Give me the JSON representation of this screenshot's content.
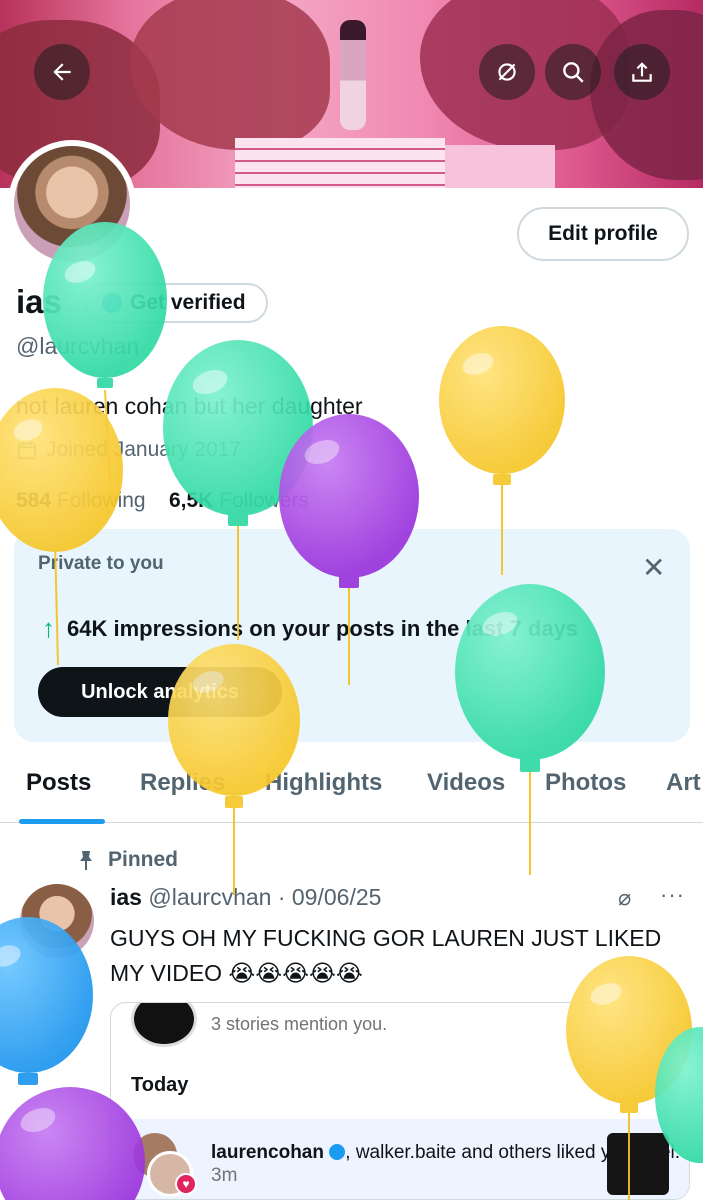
{
  "header": {
    "back_icon": "arrow-left-icon",
    "grok_icon": "grok-icon",
    "search_icon": "search-icon",
    "share_icon": "share-icon"
  },
  "profile": {
    "name": "ias",
    "get_verified": "Get verified",
    "handle": "@laurcvhan",
    "bio": "not lauren cohan but her daughter",
    "joined": "Joined January 2017",
    "following_count": "584",
    "following_label": "Following",
    "followers_count": "6,5K",
    "followers_label": "Followers",
    "edit_profile": "Edit profile"
  },
  "analytics_card": {
    "title": "Private to you",
    "impressions": "64K impressions on your posts in the last 7 days",
    "unlock": "Unlock analytics",
    "accent": "#00ba7c"
  },
  "tabs": [
    {
      "label": "Posts",
      "active": true
    },
    {
      "label": "Replies"
    },
    {
      "label": "Highlights"
    },
    {
      "label": "Videos"
    },
    {
      "label": "Photos"
    },
    {
      "label": "Art"
    }
  ],
  "post": {
    "pinned": "Pinned",
    "author": "ias",
    "handle_date": "@laurcvhan · 09/06/25",
    "text": "GUYS OH MY FUCKING GOR LAUREN JUST LIKED MY VIDEO 😭😭😭😭😭",
    "embed": {
      "mention": "3 stories mention you.",
      "today": "Today",
      "user1": "laurencohan",
      "rest": ", walker.baite and others liked your reel.",
      "time": "3m"
    }
  },
  "colors": {
    "brand_blue": "#1d9bf0",
    "balloon_green": "#3be3b0",
    "balloon_yellow": "#f9cf3a",
    "balloon_purple": "#a23ee0",
    "balloon_blue": "#2aa3f5"
  }
}
